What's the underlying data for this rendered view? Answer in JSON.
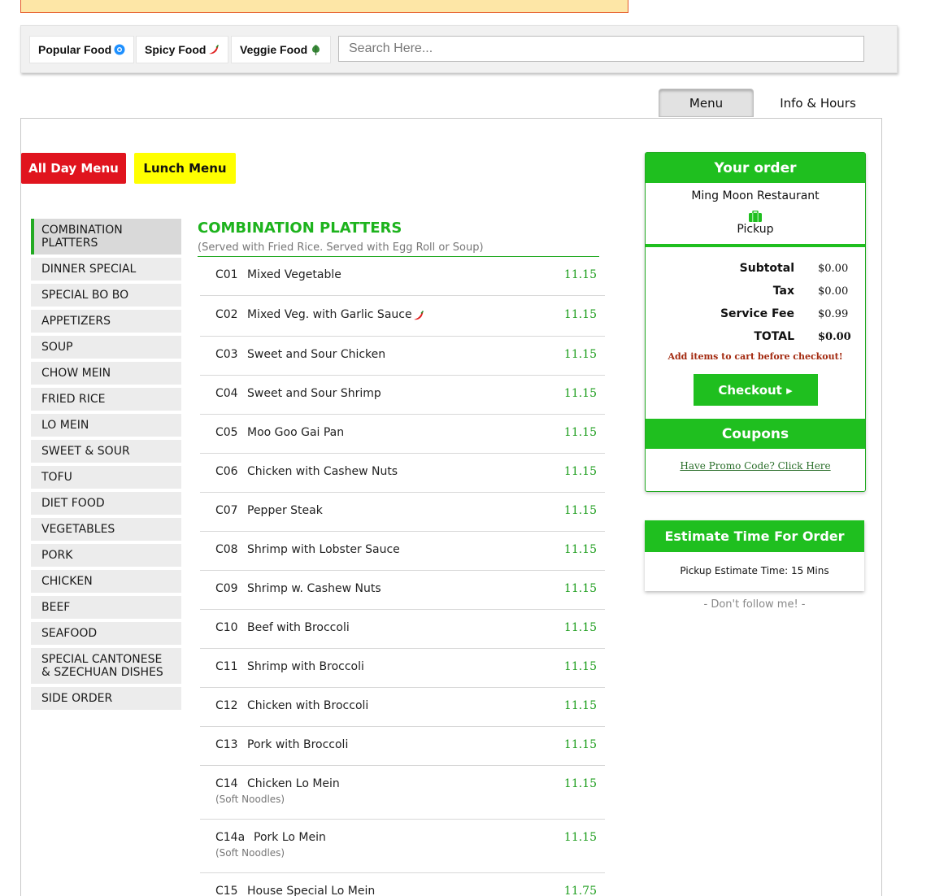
{
  "filters": [
    {
      "label": "Popular Food",
      "icon": "popular-badge-icon"
    },
    {
      "label": "Spicy Food",
      "icon": "chili-pepper-icon"
    },
    {
      "label": "Veggie Food",
      "icon": "leaf-icon"
    }
  ],
  "search": {
    "placeholder": "Search Here...",
    "value": ""
  },
  "tabs": {
    "menu": "Menu",
    "info": "Info & Hours"
  },
  "menu_buttons": {
    "all_day": "All Day Menu",
    "lunch": "Lunch Menu"
  },
  "sidebar": {
    "items": [
      "COMBINATION PLATTERS",
      "DINNER SPECIAL",
      "SPECIAL BO BO",
      "APPETIZERS",
      "SOUP",
      "CHOW MEIN",
      "FRIED RICE",
      "LO MEIN",
      "SWEET & SOUR",
      "TOFU",
      "DIET FOOD",
      "VEGETABLES",
      "PORK",
      "CHICKEN",
      "BEEF",
      "SEAFOOD",
      "SPECIAL CANTONESE & SZECHUAN DISHES",
      "SIDE ORDER"
    ]
  },
  "category": {
    "title": "COMBINATION PLATTERS",
    "subtitle": "(Served with Fried Rice. Served with Egg Roll or Soup)"
  },
  "items": [
    {
      "code": "C01",
      "name": "Mixed Vegetable",
      "price": "11.15"
    },
    {
      "code": "C02",
      "name": "Mixed Veg. with Garlic Sauce",
      "price": "11.15",
      "spicy": true
    },
    {
      "code": "C03",
      "name": "Sweet and Sour Chicken",
      "price": "11.15"
    },
    {
      "code": "C04",
      "name": "Sweet and Sour Shrimp",
      "price": "11.15"
    },
    {
      "code": "C05",
      "name": "Moo Goo Gai Pan",
      "price": "11.15"
    },
    {
      "code": "C06",
      "name": "Chicken with Cashew Nuts",
      "price": "11.15"
    },
    {
      "code": "C07",
      "name": "Pepper Steak",
      "price": "11.15"
    },
    {
      "code": "C08",
      "name": "Shrimp with Lobster Sauce",
      "price": "11.15"
    },
    {
      "code": "C09",
      "name": "Shrimp w. Cashew Nuts",
      "price": "11.15"
    },
    {
      "code": "C10",
      "name": "Beef with Broccoli",
      "price": "11.15"
    },
    {
      "code": "C11",
      "name": "Shrimp with Broccoli",
      "price": "11.15"
    },
    {
      "code": "C12",
      "name": "Chicken with Broccoli",
      "price": "11.15"
    },
    {
      "code": "C13",
      "name": "Pork with Broccoli",
      "price": "11.15"
    },
    {
      "code": "C14",
      "name": "Chicken Lo Mein",
      "price": "11.15",
      "note": "(Soft Noodles)"
    },
    {
      "code": "C14a",
      "name": "Pork Lo Mein",
      "price": "11.15",
      "note": "(Soft Noodles)"
    },
    {
      "code": "C15",
      "name": "House Special Lo Mein",
      "price": "11.75"
    }
  ],
  "order": {
    "title": "Your order",
    "restaurant": "Ming Moon Restaurant",
    "pickup": "Pickup",
    "totals": [
      {
        "label": "Subtotal",
        "value": "$0.00"
      },
      {
        "label": "Tax",
        "value": "$0.00"
      },
      {
        "label": "Service Fee",
        "value": "$0.99"
      },
      {
        "label": "TOTAL",
        "value": "$0.00"
      }
    ],
    "warning": "Add items to cart before checkout!",
    "checkout": "Checkout ▸",
    "coupons_title": "Coupons",
    "promo": "Have Promo Code? Click Here"
  },
  "estimate": {
    "title": "Estimate Time For Order",
    "text": "Pickup Estimate Time: 15 Mins"
  },
  "follow": "- Don't follow me! -",
  "colors": {
    "accent_green": "#1fbf1f",
    "all_day_red": "#e0141e",
    "lunch_yellow": "#ffff00"
  }
}
